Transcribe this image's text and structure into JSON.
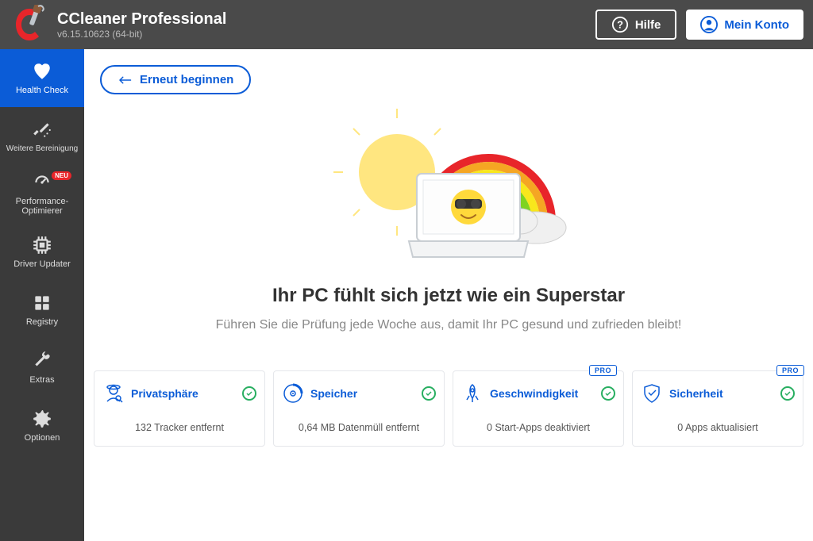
{
  "header": {
    "title": "CCleaner Professional",
    "version": "v6.15.10623 (64-bit)",
    "help": "Hilfe",
    "account": "Mein Konto"
  },
  "sidebar": {
    "items": [
      {
        "label": "Health Check"
      },
      {
        "label": "Weitere Bereinigung"
      },
      {
        "label": "Performance-Optimierer",
        "badge": "NEU"
      },
      {
        "label": "Driver Updater"
      },
      {
        "label": "Registry"
      },
      {
        "label": "Extras"
      },
      {
        "label": "Optionen"
      }
    ]
  },
  "main": {
    "restart": "Erneut beginnen",
    "headline": "Ihr PC fühlt sich jetzt wie ein Superstar",
    "subline": "Führen Sie die Prüfung jede Woche aus, damit Ihr PC gesund und zufrieden bleibt!"
  },
  "cards": [
    {
      "title": "Privatsphäre",
      "text": "132 Tracker entfernt",
      "pro": false
    },
    {
      "title": "Speicher",
      "text": "0,64 MB Datenmüll entfernt",
      "pro": false
    },
    {
      "title": "Geschwindigkeit",
      "text": "0 Start-Apps deaktiviert",
      "pro": true
    },
    {
      "title": "Sicherheit",
      "text": "0 Apps aktualisiert",
      "pro": true
    }
  ],
  "pro_label": "PRO"
}
